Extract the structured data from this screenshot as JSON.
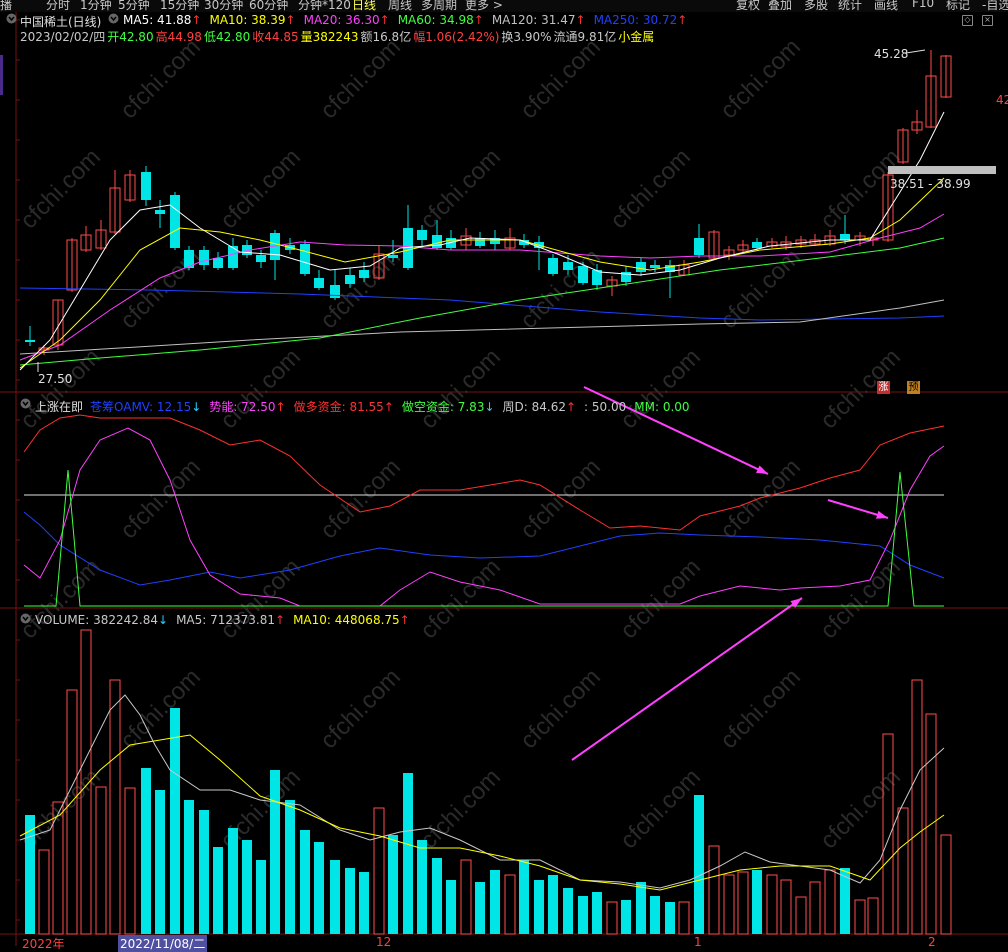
{
  "toolbar": {
    "left_cut": "播",
    "periods": [
      "分时",
      "1分钟",
      "5分钟",
      "15分钟",
      "30分钟",
      "60分钟",
      "分钟*120",
      "日线",
      "周线",
      "多周期",
      "更多 >"
    ],
    "active_period": "日线",
    "right_buttons": [
      "复权",
      "叠加",
      "多股",
      "统计",
      "画线",
      "F10",
      "标记",
      "-自选"
    ]
  },
  "main": {
    "stock_title": "中国稀土(日线)",
    "ma": [
      {
        "label": "MA5: 41.88",
        "arrow": "↑",
        "color": "#ffffff"
      },
      {
        "label": "MA10: 38.39",
        "arrow": "↑",
        "color": "#ffff00"
      },
      {
        "label": "MA20: 36.30",
        "arrow": "↑",
        "color": "#ff40ff"
      },
      {
        "label": "MA60: 34.98",
        "arrow": "↑",
        "color": "#40ff40"
      },
      {
        "label": "MA120: 31.47",
        "arrow": "↑",
        "color": "#c0c0c0"
      },
      {
        "label": "MA250: 30.72",
        "arrow": "↑",
        "color": "#2040ff"
      }
    ],
    "quote_line": [
      {
        "text": "2023/02/02/四",
        "color": "#c8c8c8"
      },
      {
        "text": "开42.80",
        "color": "#40ff40"
      },
      {
        "text": "高44.98",
        "color": "#ff4040"
      },
      {
        "text": "低42.80",
        "color": "#40ff40"
      },
      {
        "text": "收44.85",
        "color": "#ff4040"
      },
      {
        "text": "量382243",
        "color": "#ffff00"
      },
      {
        "text": "额16.8亿",
        "color": "#c8c8c8"
      },
      {
        "text": "幅1.06(2.42%)",
        "color": "#ff4040"
      },
      {
        "text": "换3.90%",
        "color": "#c8c8c8"
      },
      {
        "text": "流通9.81亿",
        "color": "#c8c8c8"
      },
      {
        "text": "小金属",
        "color": "#ffff00"
      }
    ],
    "high_label": "45.28",
    "low_label": "27.50",
    "price_box_label": "38.51 - 38.99",
    "right_axis_label": "42",
    "badges": [
      {
        "text": "涨",
        "bg": "#c03030",
        "fg": "#ffffff"
      },
      {
        "text": "预",
        "bg": "#c08020",
        "fg": "#000000"
      }
    ]
  },
  "indicator": {
    "name": "上涨在即",
    "params": [
      {
        "label": "苍筹OAMV: 12.15",
        "arrow": "↓",
        "color": "#2040ff"
      },
      {
        "label": "势能: 72.50",
        "arrow": "↑",
        "color": "#ff40ff"
      },
      {
        "label": "做多资金: 81.55",
        "arrow": "↑",
        "color": "#ff3030"
      },
      {
        "label": "做空资金: 7.83",
        "arrow": "↓",
        "color": "#40ff40"
      },
      {
        "label": "周D: 84.62",
        "arrow": "↑",
        "color": "#c8c8c8"
      },
      {
        "label": ": 50.00",
        "arrow": "",
        "color": "#c8c8c8"
      },
      {
        "label": "MM: 0.00",
        "arrow": "",
        "color": "#40ff40"
      }
    ]
  },
  "volume": {
    "params": [
      {
        "label": "VOLUME: 382242.84",
        "arrow": "↓",
        "color": "#c8c8c8"
      },
      {
        "label": "MA5: 712373.81",
        "arrow": "↑",
        "color": "#c8c8c8"
      },
      {
        "label": "MA10: 448068.75",
        "arrow": "↑",
        "color": "#ffff00"
      }
    ],
    "date_labels": [
      "2022年",
      "2022/11/08/二",
      "12",
      "1",
      "2"
    ]
  },
  "watermark": "cfchi.com",
  "colors": {
    "up": "#ff4b4b",
    "down": "#00e6e6",
    "bg": "#000000"
  }
}
